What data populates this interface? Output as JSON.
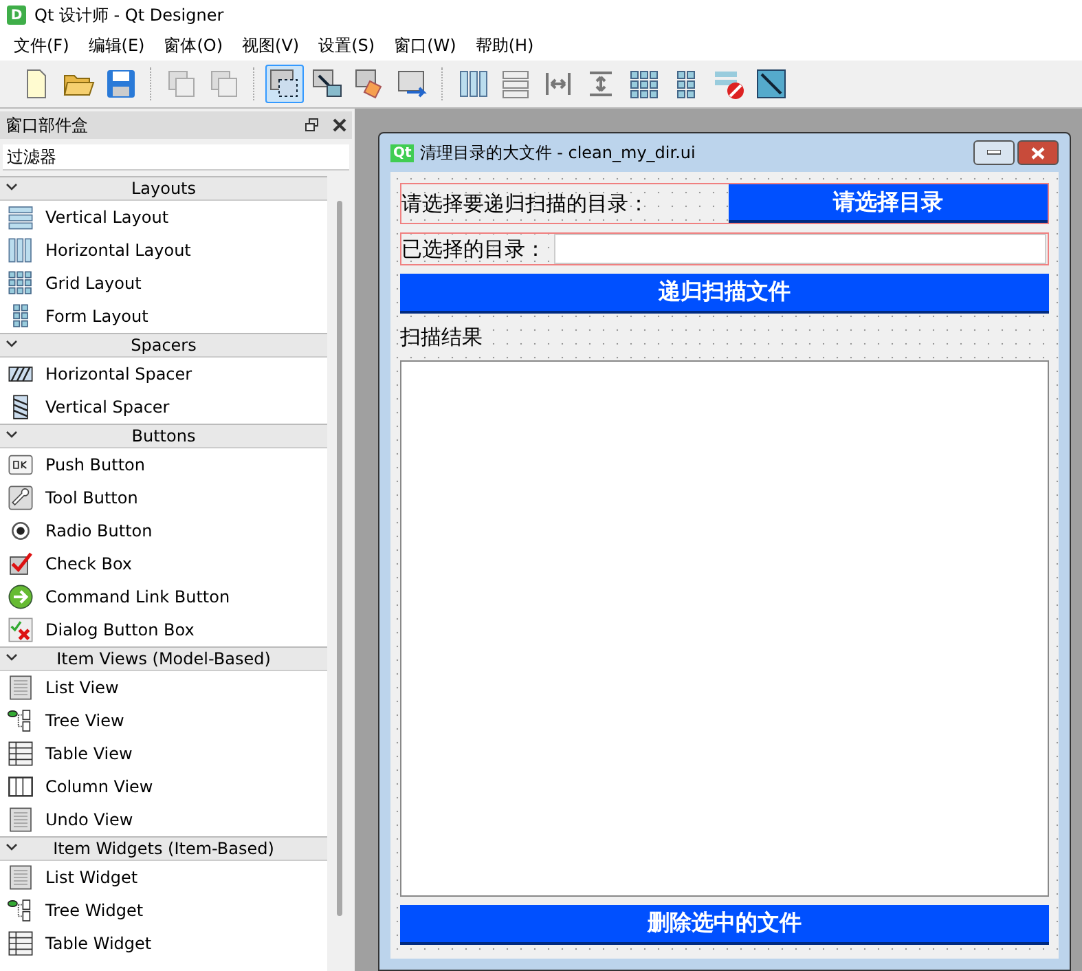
{
  "window": {
    "logo": "D",
    "title": "Qt 设计师 - Qt Designer"
  },
  "menu": [
    "文件(F)",
    "编辑(E)",
    "窗体(O)",
    "视图(V)",
    "设置(S)",
    "窗口(W)",
    "帮助(H)"
  ],
  "toolbar": [
    {
      "kind": "new",
      "selected": false
    },
    {
      "kind": "open",
      "selected": false
    },
    {
      "kind": "save",
      "selected": false
    },
    {
      "kind": "sep"
    },
    {
      "kind": "back",
      "selected": false
    },
    {
      "kind": "front",
      "selected": false
    },
    {
      "kind": "sep"
    },
    {
      "kind": "edit",
      "selected": true
    },
    {
      "kind": "signals",
      "selected": false
    },
    {
      "kind": "buddy",
      "selected": false
    },
    {
      "kind": "taborder",
      "selected": false
    },
    {
      "kind": "sep"
    },
    {
      "kind": "hlayout",
      "selected": false
    },
    {
      "kind": "vlayout",
      "selected": false
    },
    {
      "kind": "hsplit",
      "selected": false
    },
    {
      "kind": "vsplit",
      "selected": false
    },
    {
      "kind": "grid",
      "selected": false
    },
    {
      "kind": "form",
      "selected": false
    },
    {
      "kind": "break",
      "selected": false
    },
    {
      "kind": "adjust",
      "selected": false
    }
  ],
  "widget_box": {
    "title": "窗口部件盒",
    "filter": {
      "placeholder": "过滤器"
    },
    "groups": [
      {
        "title": "Layouts",
        "expanded": true,
        "items": [
          {
            "label": "Vertical Layout",
            "kind": "vlayout"
          },
          {
            "label": "Horizontal Layout",
            "kind": "hlayout"
          },
          {
            "label": "Grid Layout",
            "kind": "grid"
          },
          {
            "label": "Form Layout",
            "kind": "form"
          }
        ]
      },
      {
        "title": "Spacers",
        "expanded": true,
        "items": [
          {
            "label": "Horizontal Spacer",
            "kind": "hspacer"
          },
          {
            "label": "Vertical Spacer",
            "kind": "vspacer"
          }
        ]
      },
      {
        "title": "Buttons",
        "expanded": true,
        "items": [
          {
            "label": "Push Button",
            "kind": "push"
          },
          {
            "label": "Tool Button",
            "kind": "tool"
          },
          {
            "label": "Radio Button",
            "kind": "radio"
          },
          {
            "label": "Check Box",
            "kind": "check"
          },
          {
            "label": "Command Link Button",
            "kind": "command"
          },
          {
            "label": "Dialog Button Box",
            "kind": "dialog"
          }
        ]
      },
      {
        "title": "Item Views (Model-Based)",
        "expanded": true,
        "items": [
          {
            "label": "List View",
            "kind": "list"
          },
          {
            "label": "Tree View",
            "kind": "tree"
          },
          {
            "label": "Table View",
            "kind": "table"
          },
          {
            "label": "Column View",
            "kind": "column"
          },
          {
            "label": "Undo View",
            "kind": "list"
          }
        ]
      },
      {
        "title": "Item Widgets (Item-Based)",
        "expanded": true,
        "items": [
          {
            "label": "List Widget",
            "kind": "list"
          },
          {
            "label": "Tree Widget",
            "kind": "tree"
          },
          {
            "label": "Table Widget",
            "kind": "table"
          }
        ]
      }
    ]
  },
  "form": {
    "logo": "Qt",
    "title": "清理目录的大文件 - clean_my_dir.ui",
    "prompt_label": "请选择要递归扫描的目录：",
    "choose_button": "请选择目录",
    "selected_label": "已选择的目录：",
    "scan_button": "递归扫描文件",
    "result_label": "扫描结果",
    "delete_button": "删除选中的文件"
  }
}
